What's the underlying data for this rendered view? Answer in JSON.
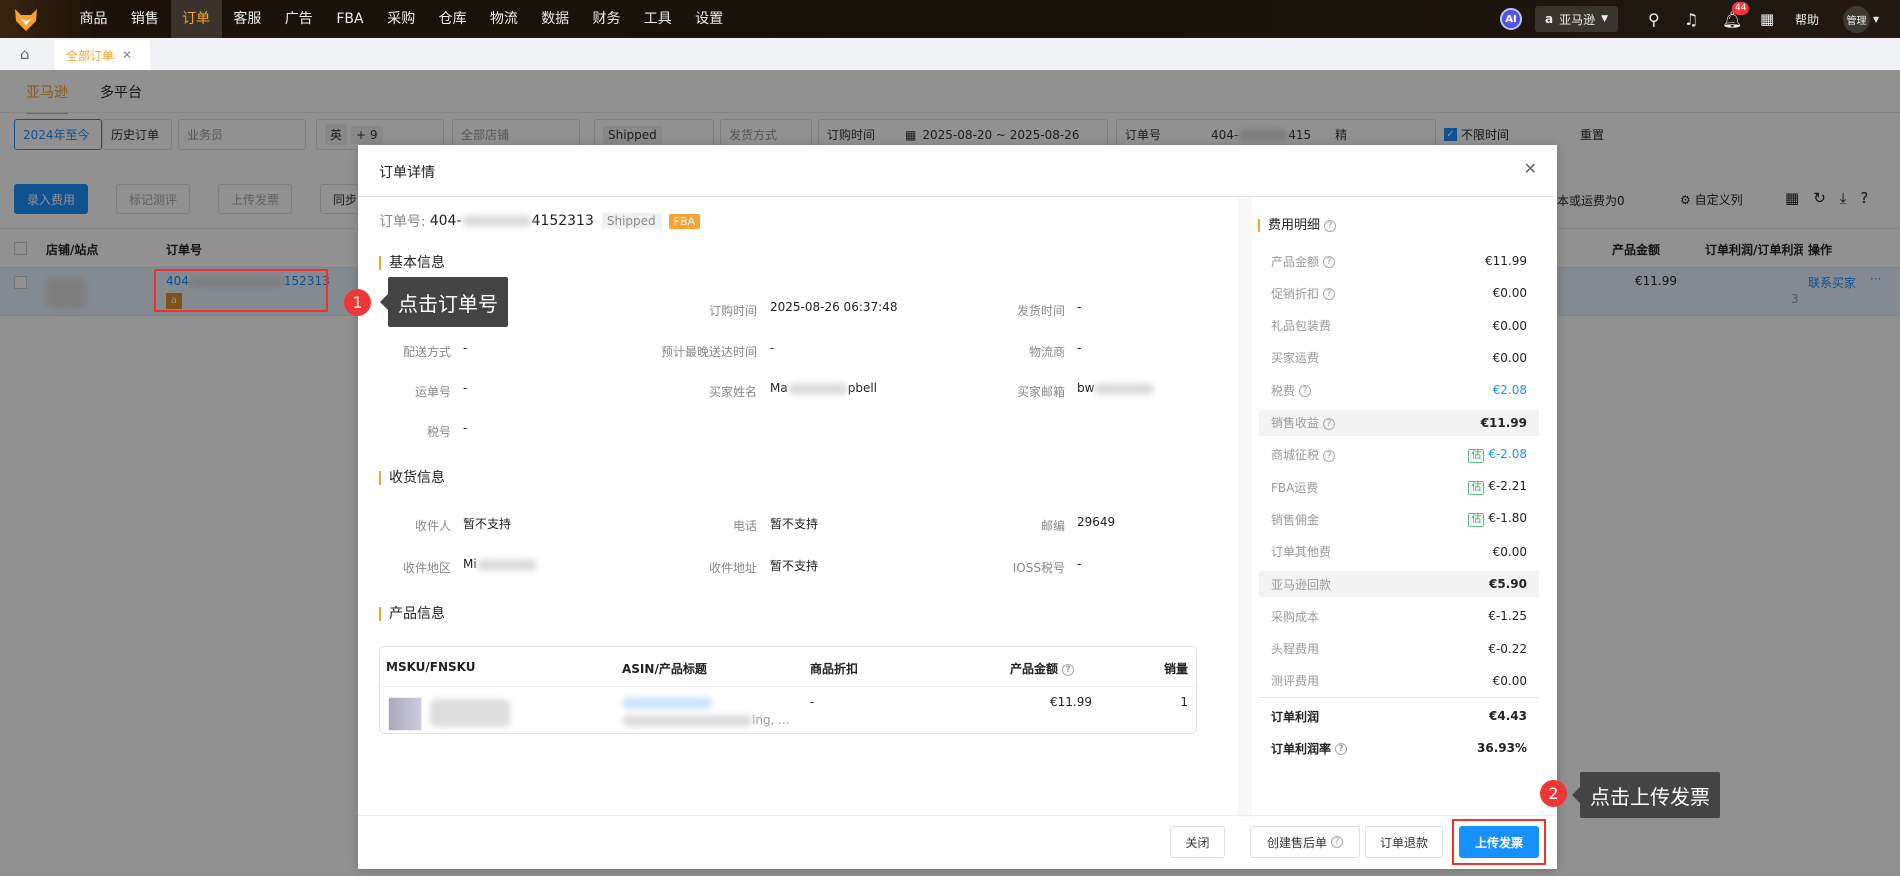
{
  "nav": {
    "items": [
      "商品",
      "销售",
      "订单",
      "客服",
      "广告",
      "FBA",
      "采购",
      "仓库",
      "物流",
      "数据",
      "财务",
      "工具",
      "设置"
    ],
    "active": "订单",
    "ai": "AI",
    "marketplace": "亚马逊",
    "notif_count": "44",
    "help": "帮助",
    "user": "管理"
  },
  "tabs": {
    "current": "全部订单"
  },
  "subtabs": [
    "亚马逊",
    "多平台"
  ],
  "filters": {
    "range_active": "2024年至今",
    "range_other": "历史订单",
    "salesperson": "业务员",
    "country_chip": "英",
    "more_chip": "+ 9",
    "shop": "全部店铺",
    "status_chip": "Shipped",
    "ship_method": "发货方式",
    "time_type": "订购时间",
    "date_range": "2025-08-20 ~ 2025-08-26",
    "search_type": "订单号",
    "search_prefix": "404-",
    "search_suffix": "415",
    "exact": "精",
    "unlimited_time": "不限时间",
    "reset": "重置"
  },
  "toolbar": {
    "enter_fee": "录入费用",
    "mark_review": "标记测评",
    "upload_invoice": "上传发票",
    "sync": "同步",
    "zero_note": "本或运费为0",
    "custom_cols": "自定义列"
  },
  "table": {
    "headers": {
      "shop": "店铺/站点",
      "order_no": "订单号",
      "amount": "产品金额",
      "profit": "订单利润/订单利润率",
      "ops": "操作"
    },
    "row": {
      "order_prefix": "404",
      "order_suffix": "152313",
      "amount": "€11.99",
      "profit_partial": "3",
      "contact": "联系买家",
      "more": "···"
    }
  },
  "modal": {
    "title": "订单详情",
    "order_label": "订单号:",
    "order_prefix": "404-",
    "order_suffix": "4152313",
    "status": "Shipped",
    "channel": "FBA",
    "basic_title": "基本信息",
    "basic": [
      {
        "label": "订购时间",
        "value": "2025-08-26 06:37:48"
      },
      {
        "label": "发货时间",
        "value": "-"
      },
      {
        "label": "配送方式",
        "value": "-"
      },
      {
        "label": "预计最晚送达时间",
        "value": "-"
      },
      {
        "label": "物流商",
        "value": "-"
      },
      {
        "label": "运单号",
        "value": "-"
      },
      {
        "label": "买家姓名",
        "value_prefix": "Ma",
        "value_suffix": "pbell"
      },
      {
        "label": "买家邮箱",
        "value_prefix": "bw",
        "value_suffix": ""
      },
      {
        "label": "税号",
        "value": "-"
      }
    ],
    "ship_title": "收货信息",
    "ship": [
      {
        "label": "收件人",
        "value": "暂不支持"
      },
      {
        "label": "电话",
        "value": "暂不支持"
      },
      {
        "label": "邮编",
        "value": "29649"
      },
      {
        "label": "收件地区",
        "value_prefix": "Mi"
      },
      {
        "label": "收件地址",
        "value": "暂不支持"
      },
      {
        "label": "IOSS税号",
        "value": "-"
      }
    ],
    "product_title": "产品信息",
    "product_headers": [
      "MSKU/FNSKU",
      "ASIN/产品标题",
      "商品折扣",
      "产品金额",
      "销量"
    ],
    "product_row": {
      "title_suffix": "ing, ...",
      "discount": "-",
      "amount": "€11.99",
      "qty": "1"
    },
    "fees_title": "费用明细",
    "fees": [
      {
        "label": "产品金额",
        "value": "€11.99",
        "help": true
      },
      {
        "label": "促销折扣",
        "value": "€0.00",
        "help": true
      },
      {
        "label": "礼品包装费",
        "value": "€0.00"
      },
      {
        "label": "买家运费",
        "value": "€0.00"
      },
      {
        "label": "税费",
        "value": "€2.08",
        "help": true,
        "blue": true
      },
      {
        "label": "销售收益",
        "value": "€11.99",
        "help": true,
        "hl": true
      },
      {
        "label": "商城征税",
        "value": "€-2.08",
        "help": true,
        "est": "估",
        "blue": true
      },
      {
        "label": "FBA运费",
        "value": "€-2.21",
        "est": "估"
      },
      {
        "label": "销售佣金",
        "value": "€-1.80",
        "est": "估"
      },
      {
        "label": "订单其他费",
        "value": "€0.00"
      },
      {
        "label": "亚马逊回款",
        "value": "€5.90",
        "hl": true
      },
      {
        "label": "采购成本",
        "value": "€-1.25"
      },
      {
        "label": "头程费用",
        "value": "€-0.22"
      },
      {
        "label": "测评费用",
        "value": "€0.00"
      }
    ],
    "profit_label": "订单利润",
    "profit": "€4.43",
    "margin_label": "订单利润率",
    "margin": "36.93%",
    "buttons": {
      "close": "关闭",
      "aftersale": "创建售后单",
      "refund": "订单退款",
      "upload": "上传发票"
    }
  },
  "annotations": [
    {
      "num": "1",
      "text": "点击订单号"
    },
    {
      "num": "2",
      "text": "点击上传发票"
    }
  ],
  "colors": {
    "accent": "#f7a233",
    "primary": "#1890ff",
    "annotation": "#ee3838"
  }
}
